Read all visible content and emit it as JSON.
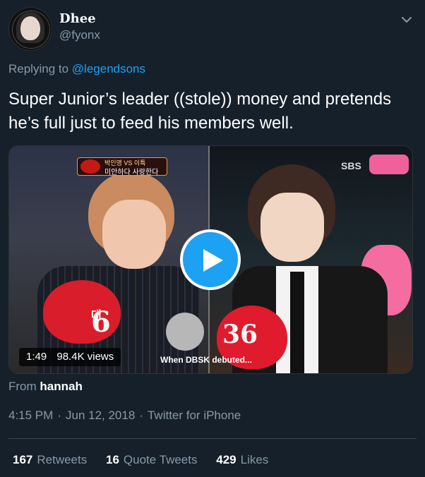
{
  "author": {
    "display_name": "Dhee",
    "handle": "@fyonx"
  },
  "reply": {
    "prefix": "Replying to",
    "mention": "@legendsons"
  },
  "tweet_text": "Super Junior’s leader ((stole)) money and pretends he’s full just to feed his members well.",
  "video": {
    "duration": "1:49",
    "views": "98.4K views",
    "subtitle": "When DBSK debuted...",
    "left_number": "6",
    "left_suffix": "대",
    "right_number": "36",
    "banner_top": "박인영 VS 이특",
    "banner_main": "미안하다 사랑한다",
    "channel": "SBS"
  },
  "source": {
    "prefix": "From",
    "name": "hannah"
  },
  "meta": {
    "time": "4:15 PM",
    "date": "Jun 12, 2018",
    "client": "Twitter for iPhone",
    "separator": "·"
  },
  "counts": {
    "retweets_num": "167",
    "retweets_label": "Retweets",
    "quotes_num": "16",
    "quotes_label": "Quote Tweets",
    "likes_num": "429",
    "likes_label": "Likes"
  },
  "colors": {
    "background": "#15202b",
    "accent": "#1da1f2",
    "secondary_text": "#8899a6"
  },
  "icons": {
    "caret": "chevron-down-icon",
    "play": "play-icon"
  }
}
